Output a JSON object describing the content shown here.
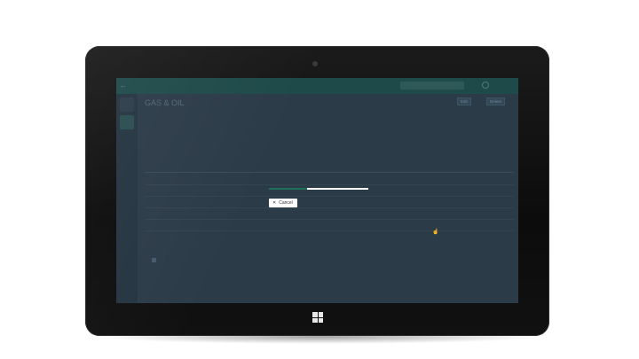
{
  "device": {
    "os_logo": "windows-logo"
  },
  "app": {
    "topbar": {
      "back_icon": "back-arrow-icon",
      "breadcrumb_1": "",
      "breadcrumb_2": "",
      "search_placeholder": "",
      "user_name": ""
    },
    "page": {
      "title": "GAS & OIL",
      "subtitle_label": "",
      "subtitle": "",
      "edit_label": "Edit",
      "delete_label": "Delete"
    },
    "section_title": "",
    "table": {
      "columns": [
        "",
        "",
        "",
        "",
        "",
        "",
        ""
      ],
      "rows": [
        [
          "",
          "",
          "",
          "",
          "",
          "",
          ""
        ],
        [
          "",
          "",
          "",
          "",
          "",
          "",
          ""
        ],
        [
          "",
          "",
          "",
          "",
          "",
          "",
          ""
        ],
        [
          "",
          "",
          "",
          "",
          "",
          "",
          ""
        ],
        [
          "",
          "",
          "",
          "",
          "",
          "",
          ""
        ]
      ]
    }
  },
  "modal": {
    "progress": 0.38,
    "progress_color": "#1e6f5c",
    "cancel_label": "Cancel",
    "cancel_icon": "close-icon"
  }
}
